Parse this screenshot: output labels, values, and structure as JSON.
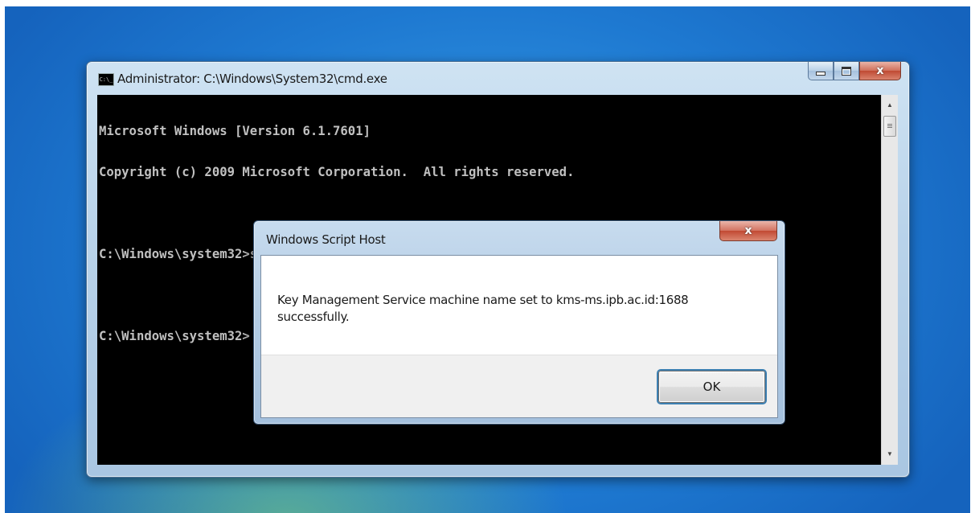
{
  "cmd_window": {
    "title": "Administrator: C:\\Windows\\System32\\cmd.exe",
    "icon_text": "C:\\_",
    "console_lines": [
      "Microsoft Windows [Version 6.1.7601]",
      "Copyright (c) 2009 Microsoft Corporation.  All rights reserved.",
      "",
      "C:\\Windows\\system32>slmgr.vbs /skms kms-ms.ipb.ac.id:1688",
      "",
      "C:\\Windows\\system32>"
    ],
    "close_glyph": "x"
  },
  "message_box": {
    "title": "Windows Script Host",
    "message_line1": "Key Management Service machine name set to kms-ms.ipb.ac.id:1688",
    "message_line2": "successfully.",
    "ok_label": "OK",
    "close_glyph": "x"
  },
  "colors": {
    "console_bg": "#000000",
    "console_text": "#c0c0c0",
    "desktop_blue": "#1e79d1"
  }
}
